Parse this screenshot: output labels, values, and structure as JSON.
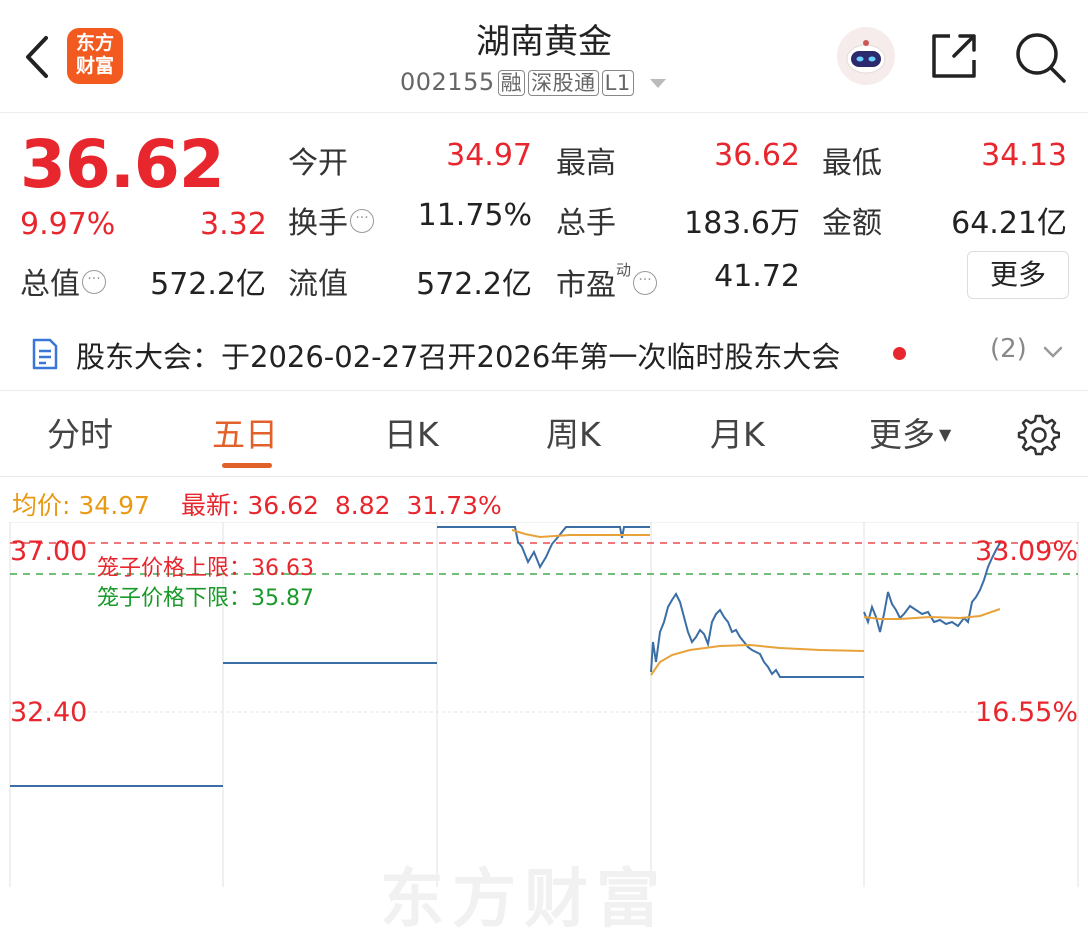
{
  "header": {
    "logo_line1": "东方",
    "logo_line2": "财富",
    "title": "湖南黄金",
    "code": "002155",
    "tags": [
      "融",
      "深股通",
      "L1"
    ]
  },
  "quote": {
    "price": "36.62",
    "change_pct": "9.97%",
    "change": "3.32",
    "rows": [
      {
        "l1": "今开",
        "v1": "34.97",
        "l2": "最高",
        "v2": "36.62",
        "l3": "最低",
        "v3": "34.13"
      },
      {
        "l1": "换手",
        "v1": "11.75%",
        "l2": "总手",
        "v2": "183.6万",
        "l3": "金额",
        "v3": "64.21亿"
      }
    ],
    "total_value_label": "总值",
    "total_value": "572.2亿",
    "float_value_label": "流值",
    "float_value": "572.2亿",
    "pe_label": "市盈",
    "pe_sup": "动",
    "pe_value": "41.72",
    "more_label": "更多"
  },
  "notice": {
    "text": "股东大会：于2026-02-27召开2026年第一次临时股东大会",
    "count": "(2)"
  },
  "tabs": [
    "分时",
    "五日",
    "日K",
    "周K",
    "月K",
    "更多"
  ],
  "active_tab": "五日",
  "legend": {
    "avg_label": "均价:",
    "avg_value": "34.97",
    "latest_label": "最新:",
    "latest_value": "36.62",
    "latest_change": "8.82",
    "latest_pct": "31.73%"
  },
  "cage": {
    "upper": "笼子价格上限：36.63",
    "lower": "笼子价格下限：35.87"
  },
  "axis": {
    "left_top": "37.00",
    "left_mid": "32.40",
    "right_top": "33.09%",
    "right_mid": "16.55%"
  },
  "watermark": "东方财富",
  "colors": {
    "up": "#e8262e",
    "accent": "#e2612a",
    "price_line": "#3a6ea5",
    "avg_line": "#e8a23a",
    "cage_low": "#1a9a2a"
  }
}
